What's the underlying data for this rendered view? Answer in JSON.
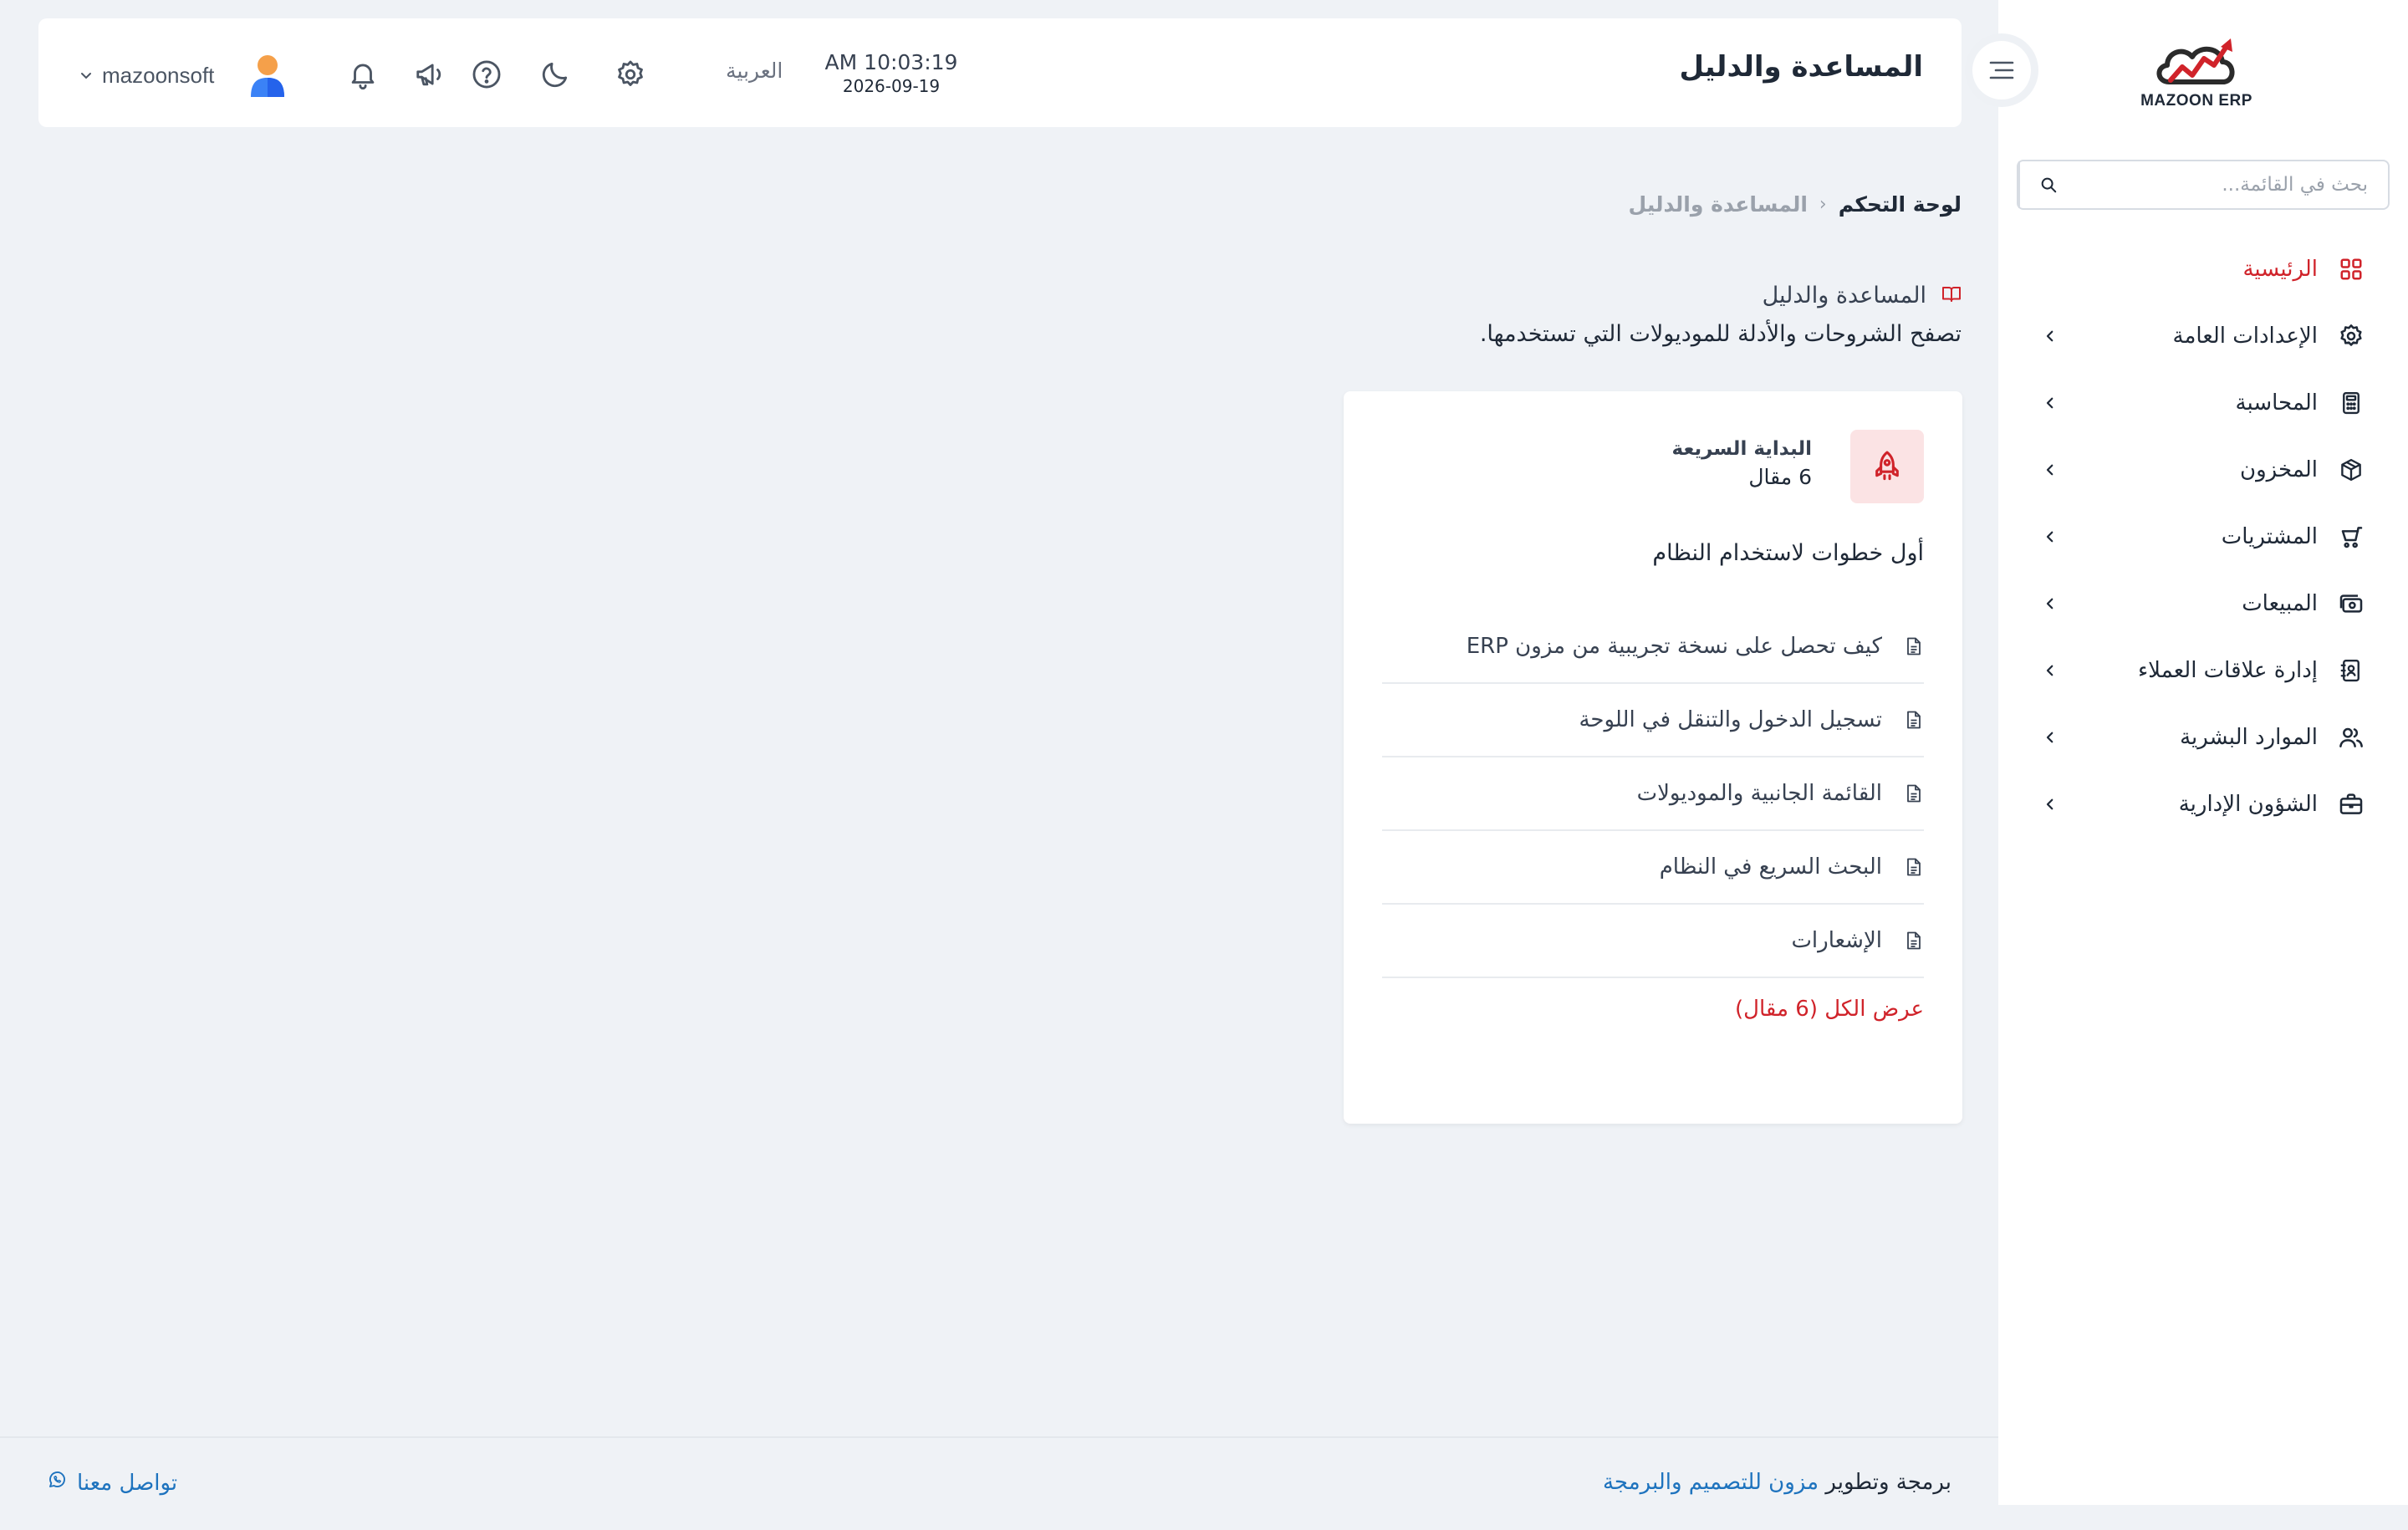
{
  "brand": {
    "logo_text": "MAZOON ERP",
    "logo_tag": "ERP",
    "accent": "#d0232a",
    "link": "#1e73be"
  },
  "sidebar": {
    "search_placeholder": "بحث في القائمة...",
    "items": [
      {
        "label": "الرئيسية",
        "icon": "grid-icon",
        "active": true
      },
      {
        "label": "الإعدادات العامة",
        "icon": "gear-icon"
      },
      {
        "label": "المحاسبة",
        "icon": "calculator-icon"
      },
      {
        "label": "المخزون",
        "icon": "box-icon"
      },
      {
        "label": "المشتريات",
        "icon": "cart-icon"
      },
      {
        "label": "المبيعات",
        "icon": "cash-icon"
      },
      {
        "label": "إدارة علاقات العملاء",
        "icon": "contacts-icon"
      },
      {
        "label": "الموارد البشرية",
        "icon": "users-icon"
      },
      {
        "label": "الشؤون الإدارية",
        "icon": "briefcase-icon"
      }
    ]
  },
  "header": {
    "title": "المساعدة والدليل",
    "time": "AM 10:03:19",
    "date": "2026-09-19",
    "language": "العربية",
    "username": "mazoonsoft"
  },
  "breadcrumb": {
    "home": "لوحة التحكم",
    "separator": "‹",
    "current": "المساعدة والدليل"
  },
  "page": {
    "heading": "المساعدة والدليل",
    "description": "تصفح الشروحات والأدلة للموديولات التي تستخدمها."
  },
  "card": {
    "title": "البداية السريعة",
    "count": "6 مقال",
    "description": "أول خطوات لاستخدام النظام",
    "articles": [
      "كيف تحصل على نسخة تجريبية من مزون ERP",
      "تسجيل الدخول والتنقل في اللوحة",
      "القائمة الجانبية والموديولات",
      "البحث السريع في النظام",
      "الإشعارات"
    ],
    "view_all": "عرض الكل (6 مقال)"
  },
  "footer": {
    "credit_prefix": "برمجة وتطوير",
    "credit_link": "مزون للتصميم والبرمجة",
    "contact": "تواصل معنا"
  }
}
